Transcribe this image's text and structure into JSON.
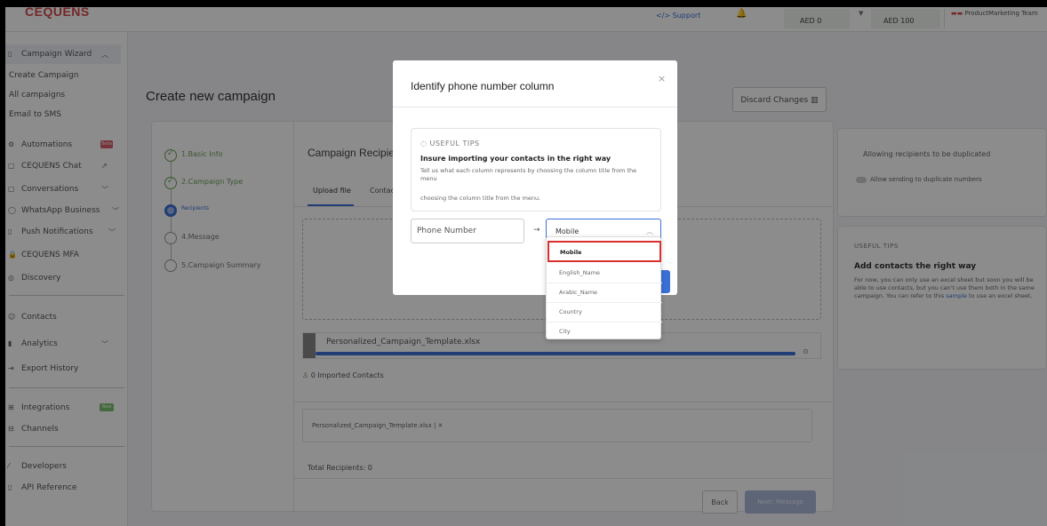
{
  "header": {
    "logo": "CEQUENS",
    "support": "</> Support",
    "balance_1": "AED 0",
    "balance_2": "AED 100",
    "team": "ProductMarketing Team",
    "team_mark": "▬▬"
  },
  "sidebar": {
    "campaign_wizard": "Campaign Wizard",
    "sub_items": [
      "Create Campaign",
      "All campaigns",
      "Email to SMS"
    ],
    "items": [
      {
        "label": "Automations",
        "badge": "Beta"
      },
      {
        "label": "CEQUENS Chat"
      },
      {
        "label": "Conversations"
      },
      {
        "label": "WhatsApp Business"
      },
      {
        "label": "Push Notifications"
      },
      {
        "label": "CEQUENS MFA"
      },
      {
        "label": "Discovery"
      },
      {
        "label": "Contacts"
      },
      {
        "label": "Analytics"
      },
      {
        "label": "Export History"
      },
      {
        "label": "Integrations",
        "badge": "New"
      },
      {
        "label": "Channels"
      },
      {
        "label": "Developers"
      },
      {
        "label": "API Reference"
      }
    ]
  },
  "main": {
    "page_title": "Create new campaign",
    "discard_label": "Discard Changes",
    "steps": [
      {
        "label": "1.Basic Info",
        "state": "done"
      },
      {
        "label": "2.Campaign Type",
        "state": "done"
      },
      {
        "label": "Recipients",
        "state": "active"
      },
      {
        "label": "4.Message",
        "state": "pending"
      },
      {
        "label": "5.Campaign Summary",
        "state": "pending"
      }
    ],
    "recipients_title": "Campaign Recipients",
    "tabs": [
      "Upload file",
      "Contacts"
    ],
    "file_name": "Personalized_Campaign_Template.xlsx",
    "progress": 1.0,
    "imported": "0 Imported Contacts",
    "uploaded_file": "Personalized_Campaign_Template.xlsx | ✕",
    "total_recipients": "Total Recipients: 0",
    "back_label": "Back",
    "next_label": "Next: Message"
  },
  "right_panel": {
    "duplicate_title": "Allowing recipients to be duplicated",
    "duplicate_toggle_label": "Allow sending to duplicate numbers",
    "tips_label": "USEFUL TIPS",
    "tips_title": "Add contacts the right way",
    "tips_text": "For now, you can only use an excel sheet but soon you will be able to use contacts, but you can't use them both in the same campaign. You can refer to this",
    "tips_link": "sample",
    "tips_text_end": "to use an excel sheet."
  },
  "modal": {
    "title": "Identify phone number column",
    "close": "×",
    "tips_label": "USEFUL TIPS",
    "tips_title": "Insure importing your contacts in the right way",
    "tips_text": "Tell us what each column represents by choosing the column title from the menu",
    "tips_text_2": "choosing the column title from the menu.",
    "phone_label": "Phone Number",
    "arrow": "→",
    "selected": "Mobile",
    "options": [
      "Mobile",
      "English_Name",
      "Arabic_Name",
      "Country",
      "City"
    ],
    "selected_index": 0
  },
  "colors": {
    "accent": "#3b6fd8",
    "success": "#6ba05a",
    "highlight_border": "#d9302e",
    "logo": "#d44a4a"
  }
}
